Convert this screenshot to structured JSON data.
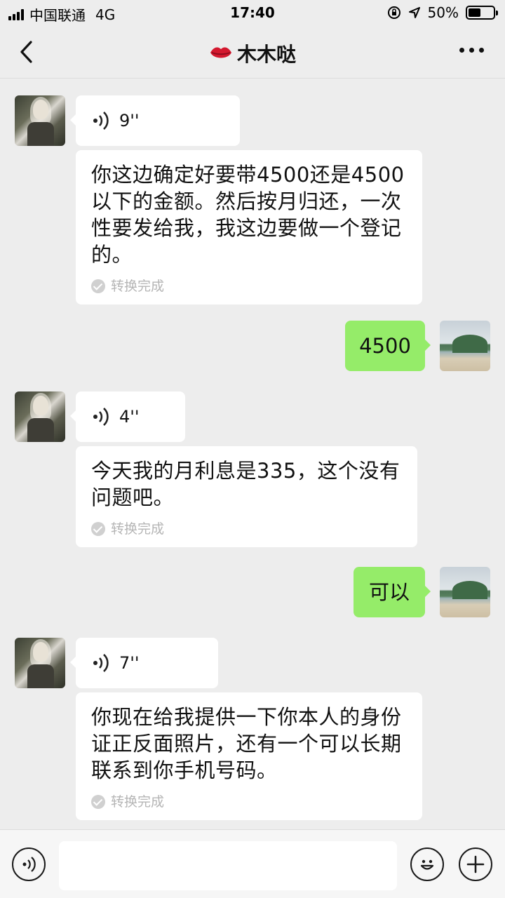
{
  "status_bar": {
    "carrier": "中国联通",
    "network": "4G",
    "time": "17:40",
    "battery_text": "50%",
    "battery_level": 0.5
  },
  "nav": {
    "title": "木木哒",
    "title_icon": "lips-icon",
    "back_icon": "chevron-left-icon",
    "more_icon": "more-dots-icon"
  },
  "messages": [
    {
      "sender": "other",
      "voice_duration": "9''",
      "transcript": "你这边确定好要带4500还是4500\n以下的金额。然后按月归还，一次\n性要发给我，我这边要做一个登记\n的。",
      "status": "转换完成"
    },
    {
      "sender": "me",
      "text": "4500"
    },
    {
      "sender": "other",
      "voice_duration": "4''",
      "transcript": "今天我的月利息是335，这个没有\n问题吧。",
      "status": "转换完成"
    },
    {
      "sender": "me",
      "text": "可以"
    },
    {
      "sender": "other",
      "voice_duration": "7''",
      "transcript": "你现在给我提供一下你本人的身份\n证正反面照片，还有一个可以长期\n联系到你手机号码。",
      "status": "转换完成"
    }
  ],
  "input_bar": {
    "voice_icon": "voice-icon",
    "emoji_icon": "emoji-icon",
    "plus_icon": "plus-icon",
    "placeholder": ""
  },
  "colors": {
    "background": "#ededed",
    "my_bubble": "#95ec69",
    "other_bubble": "#ffffff"
  }
}
